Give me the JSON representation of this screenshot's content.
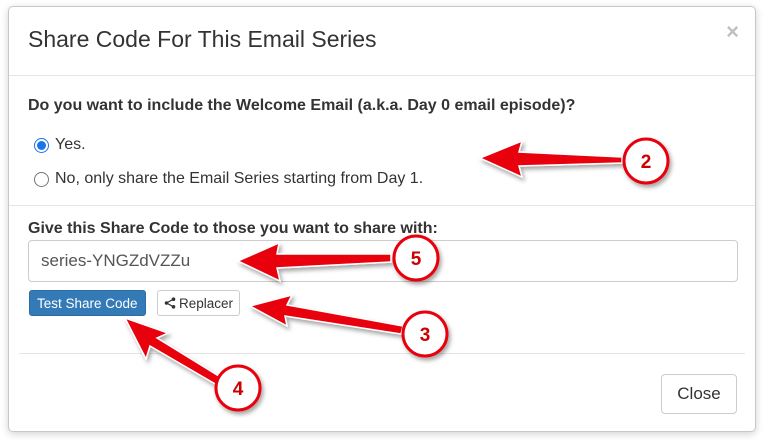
{
  "dialog": {
    "title": "Share Code For This Email Series",
    "close_glyph": "×",
    "question": "Do you want to include the Welcome Email (a.k.a. Day 0 email episode)?",
    "options": [
      {
        "label": "Yes.",
        "checked": true
      },
      {
        "label": "No, only share the Email Series starting from Day 1.",
        "checked": false
      }
    ],
    "share_label": "Give this Share Code to those you want to share with:",
    "share_code": "series-YNGZdVZZu",
    "test_button": "Test Share Code",
    "replacer_button": "Replacer",
    "replacer_icon": "share-icon",
    "close_button": "Close"
  },
  "annotations": {
    "callouts": [
      "2",
      "5",
      "3",
      "4"
    ],
    "color": "#e8000b"
  }
}
